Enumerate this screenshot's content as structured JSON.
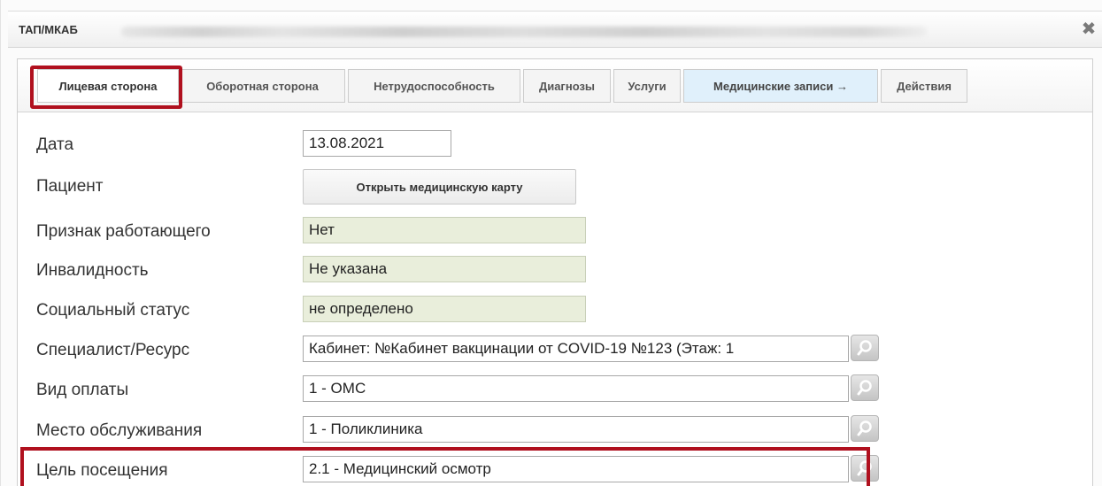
{
  "window": {
    "title": "ТАП/МКАБ",
    "close_symbol": "✖"
  },
  "tabs": [
    {
      "label": "Лицевая сторона"
    },
    {
      "label": "Оборотная сторона"
    },
    {
      "label": "Нетрудоспособность"
    },
    {
      "label": "Диагнозы"
    },
    {
      "label": "Услуги"
    },
    {
      "label": "Медицинские записи →"
    },
    {
      "label": "Действия"
    }
  ],
  "form": {
    "date": {
      "label": "Дата",
      "value": "13.08.2021"
    },
    "patient": {
      "label": "Пациент",
      "button": "Открыть медицинскую карту"
    },
    "working": {
      "label": "Признак работающего",
      "value": "Нет"
    },
    "disability": {
      "label": "Инвалидность",
      "value": "Не указана"
    },
    "social_status": {
      "label": "Социальный статус",
      "value": "не определено"
    },
    "specialist": {
      "label": "Специалист/Ресурс",
      "value": "Кабинет: №Кабинет вакцинации от COVID-19  №123 (Этаж: 1"
    },
    "payment": {
      "label": "Вид оплаты",
      "value": "1 - ОМС"
    },
    "place": {
      "label": "Место обслуживания",
      "value": "1 - Поликлиника"
    },
    "purpose": {
      "label": "Цель посещения",
      "value": "2.1 - Медицинский осмотр"
    }
  },
  "colors": {
    "highlight": "#b0101e",
    "readonly_bg": "#e9eedb",
    "blue_tab_bg": "#e0f0fb"
  },
  "icons": {
    "close": "close-icon",
    "lookup": "search-icon"
  }
}
